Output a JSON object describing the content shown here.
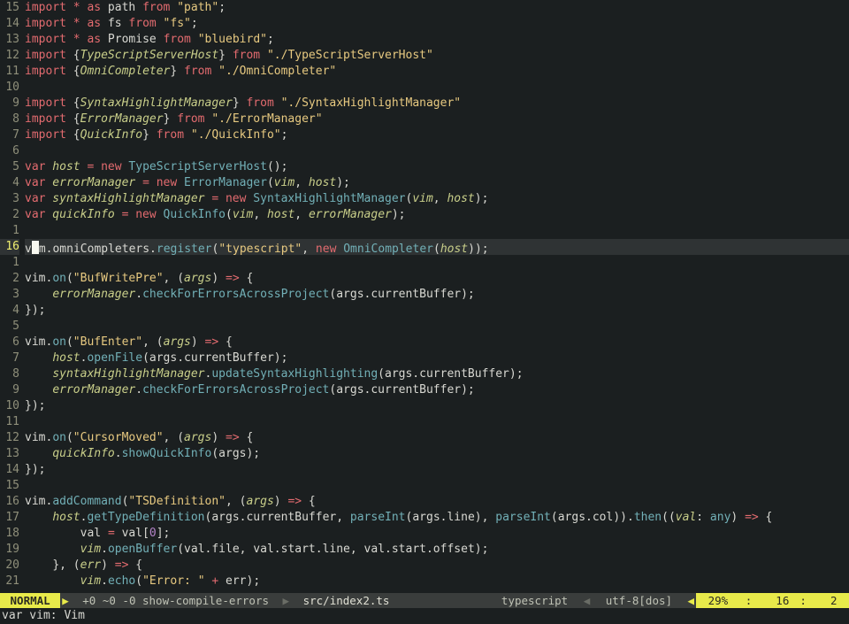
{
  "gutter": {
    "above": [
      15,
      14,
      13,
      12,
      11,
      10,
      9,
      8,
      7,
      6,
      5,
      4,
      3,
      2,
      1
    ],
    "current": 16,
    "below": [
      1,
      2,
      3,
      4,
      5,
      6,
      7,
      8,
      9,
      10,
      11,
      12,
      13,
      14,
      15,
      16,
      17,
      18,
      19,
      20,
      21
    ]
  },
  "code": {
    "l0": {
      "a": "import",
      "b": " * ",
      "c": "as",
      "d": " path ",
      "e": "from",
      "f": " \"path\"",
      "g": ";"
    },
    "l1": {
      "a": "import",
      "b": " * ",
      "c": "as",
      "d": " fs ",
      "e": "from",
      "f": " \"fs\"",
      "g": ";"
    },
    "l2": {
      "a": "import",
      "b": " * ",
      "c": "as",
      "d": " Promise ",
      "e": "from",
      "f": " \"bluebird\"",
      "g": ";"
    },
    "l3": {
      "a": "import",
      "b": " {",
      "c": "TypeScriptServerHost",
      "d": "} ",
      "e": "from",
      "f": " \"./TypeScriptServerHost\""
    },
    "l4": {
      "a": "import",
      "b": " {",
      "c": "OmniCompleter",
      "d": "} ",
      "e": "from",
      "f": " \"./OmniCompleter\""
    },
    "l5": "",
    "l6": {
      "a": "import",
      "b": " {",
      "c": "SyntaxHighlightManager",
      "d": "} ",
      "e": "from",
      "f": " \"./SyntaxHighlightManager\""
    },
    "l7": {
      "a": "import",
      "b": " {",
      "c": "ErrorManager",
      "d": "} ",
      "e": "from",
      "f": " \"./ErrorManager\""
    },
    "l8": {
      "a": "import",
      "b": " {",
      "c": "QuickInfo",
      "d": "} ",
      "e": "from",
      "f": " \"./QuickInfo\"",
      "g": ";"
    },
    "l9": "",
    "l10": {
      "a": "var",
      "b": " host ",
      "c": "=",
      "d": " new ",
      "e": "TypeScriptServerHost",
      "f": "();"
    },
    "l11": {
      "a": "var",
      "b": " errorManager ",
      "c": "=",
      "d": " new ",
      "e": "ErrorManager",
      "f": "(",
      "g": "vim",
      "h": ", ",
      "i": "host",
      "j": ");"
    },
    "l12": {
      "a": "var",
      "b": " syntaxHighlightManager ",
      "c": "=",
      "d": " new ",
      "e": "SyntaxHighlightManager",
      "f": "(",
      "g": "vim",
      "h": ", ",
      "i": "host",
      "j": ");"
    },
    "l13": {
      "a": "var",
      "b": " quickInfo ",
      "c": "=",
      "d": " new ",
      "e": "QuickInfo",
      "f": "(",
      "g": "vim",
      "h": ", ",
      "i": "host",
      "j": ", ",
      "k": "errorManager",
      "l": ");"
    },
    "l14": "",
    "l15": {
      "pre": "v",
      "post": "m",
      "a": ".omniCompleters.",
      "b": "register",
      "c": "(",
      "d": "\"typescript\"",
      "e": ", ",
      "f": "new",
      "g": " ",
      "h": "OmniCompleter",
      "i": "(",
      "j": "host",
      "k": "));"
    },
    "l16": "",
    "l17": {
      "a": "vim.",
      "b": "on",
      "c": "(",
      "d": "\"BufWritePre\"",
      "e": ", (",
      "f": "args",
      "g": ") ",
      "h": "=>",
      "i": " {"
    },
    "l18": {
      "ind": "    ",
      "a": "errorManager",
      "b": ".",
      "c": "checkForErrorsAcrossProject",
      "d": "(args.currentBuffer);"
    },
    "l19": "});",
    "l20": "",
    "l21": {
      "a": "vim.",
      "b": "on",
      "c": "(",
      "d": "\"BufEnter\"",
      "e": ", (",
      "f": "args",
      "g": ") ",
      "h": "=>",
      "i": " {"
    },
    "l22": {
      "ind": "    ",
      "a": "host",
      "b": ".",
      "c": "openFile",
      "d": "(args.currentBuffer);"
    },
    "l23": {
      "ind": "    ",
      "a": "syntaxHighlightManager",
      "b": ".",
      "c": "updateSyntaxHighlighting",
      "d": "(args.currentBuffer);"
    },
    "l24": {
      "ind": "    ",
      "a": "errorManager",
      "b": ".",
      "c": "checkForErrorsAcrossProject",
      "d": "(args.currentBuffer);"
    },
    "l25": "});",
    "l26": "",
    "l27": {
      "a": "vim.",
      "b": "on",
      "c": "(",
      "d": "\"CursorMoved\"",
      "e": ", (",
      "f": "args",
      "g": ") ",
      "h": "=>",
      "i": " {"
    },
    "l28": {
      "ind": "    ",
      "a": "quickInfo",
      "b": ".",
      "c": "showQuickInfo",
      "d": "(args);"
    },
    "l29": "});",
    "l30": "",
    "l31": {
      "a": "vim.",
      "b": "addCommand",
      "c": "(",
      "d": "\"TSDefinition\"",
      "e": ", (",
      "f": "args",
      "g": ") ",
      "h": "=>",
      "i": " {"
    },
    "l32": {
      "ind": "    ",
      "a": "host",
      "b": ".",
      "c": "getTypeDefinition",
      "d": "(args.currentBuffer, ",
      "e": "parseInt",
      "f": "(args.line), ",
      "g": "parseInt",
      "h": "(args.col)).",
      "i": "then",
      "j": "((",
      "k": "val",
      "l": ": ",
      "m": "any",
      "n": ") ",
      "o": "=>",
      "p": " {"
    },
    "l33": {
      "ind": "        ",
      "a": "val ",
      "b": "=",
      "c": " val[",
      "d": "0",
      "e": "];"
    },
    "l34": {
      "ind": "        ",
      "a": "vim",
      "b": ".",
      "c": "openBuffer",
      "d": "(val.file, val.start.line, val.start.offset);"
    },
    "l35": {
      "ind": "    ",
      "a": "}, (",
      "b": "err",
      "c": ") ",
      "d": "=>",
      "e": " {"
    },
    "l36": {
      "ind": "        ",
      "a": "vim",
      "b": ".",
      "c": "echo",
      "d": "(",
      "e": "\"Error: \"",
      "f": " ",
      "g": "+",
      "h": " err);"
    }
  },
  "status": {
    "mode": " NORMAL ",
    "branch": " +0 ~0 -0 show-compile-errors ",
    "file": " src/index2.ts ",
    "filetype": " typescript ",
    "encoding": " utf-8[dos] ",
    "percent": " 29% ",
    "pos_line": "  16",
    "pos_col": "  2 ",
    "colon": ":"
  },
  "cmdline": "var vim: Vim"
}
